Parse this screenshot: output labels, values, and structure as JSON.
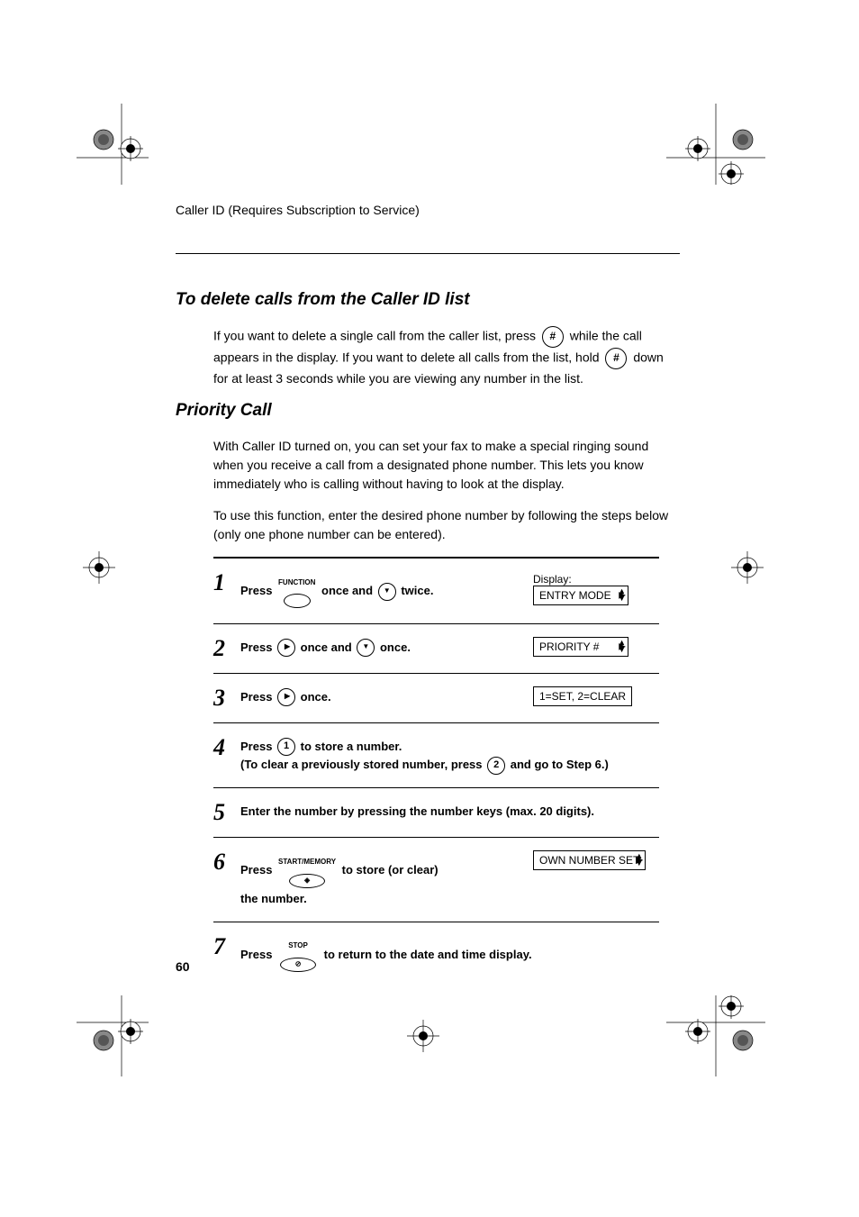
{
  "header": "Caller ID (Requires Subscription to Service)",
  "section1_title": "To delete calls from the Caller ID list",
  "section1_para_a": "If you want to delete a single call from the caller list, press ",
  "section1_para_b": " while the call appears in the display. If you want to delete all calls from the list, hold ",
  "section1_para_c": " down for at least 3 seconds while you are viewing any number in the list.",
  "hash_key": "#",
  "section2_title": "Priority Call",
  "section2_para1": "With Caller ID turned on, you can set your fax to make a special ringing sound when you receive a call from a designated phone number. This lets you know immediately who is calling without having to look at the display.",
  "section2_para2": "To use this function, enter the desired phone number by following the steps below (only one phone number can be entered).",
  "display_label": "Display:",
  "steps": {
    "s1": {
      "num": "1",
      "press": "Press",
      "func": "FUNCTION",
      "once_and": " once and ",
      "twice": " twice."
    },
    "s2": {
      "num": "2",
      "press": "Press ",
      "once_and": " once and ",
      "once": " once."
    },
    "s3": {
      "num": "3",
      "press": "Press ",
      "once": " once."
    },
    "s4": {
      "num": "4",
      "press": "Press ",
      "store": " to store a number.",
      "clear_a": "(To clear a previously stored number, press ",
      "clear_b": " and go to Step 6.)"
    },
    "s5": {
      "num": "5",
      "text": "Enter the number by pressing the number keys (max. 20 digits)."
    },
    "s6": {
      "num": "6",
      "press": "Press ",
      "label": "START/MEMORY",
      "rest_a": " to store (or clear)",
      "rest_b": "the number."
    },
    "s7": {
      "num": "7",
      "press": "Press ",
      "label": "STOP",
      "rest": " to return to the date and time display."
    }
  },
  "keys": {
    "one": "1",
    "two": "2"
  },
  "lcd": {
    "entry": "ENTRY MODE",
    "priority": "PRIORITY #",
    "setclear": "1=SET, 2=CLEAR",
    "ownnum": "OWN NUMBER SET"
  },
  "page_num": "60"
}
